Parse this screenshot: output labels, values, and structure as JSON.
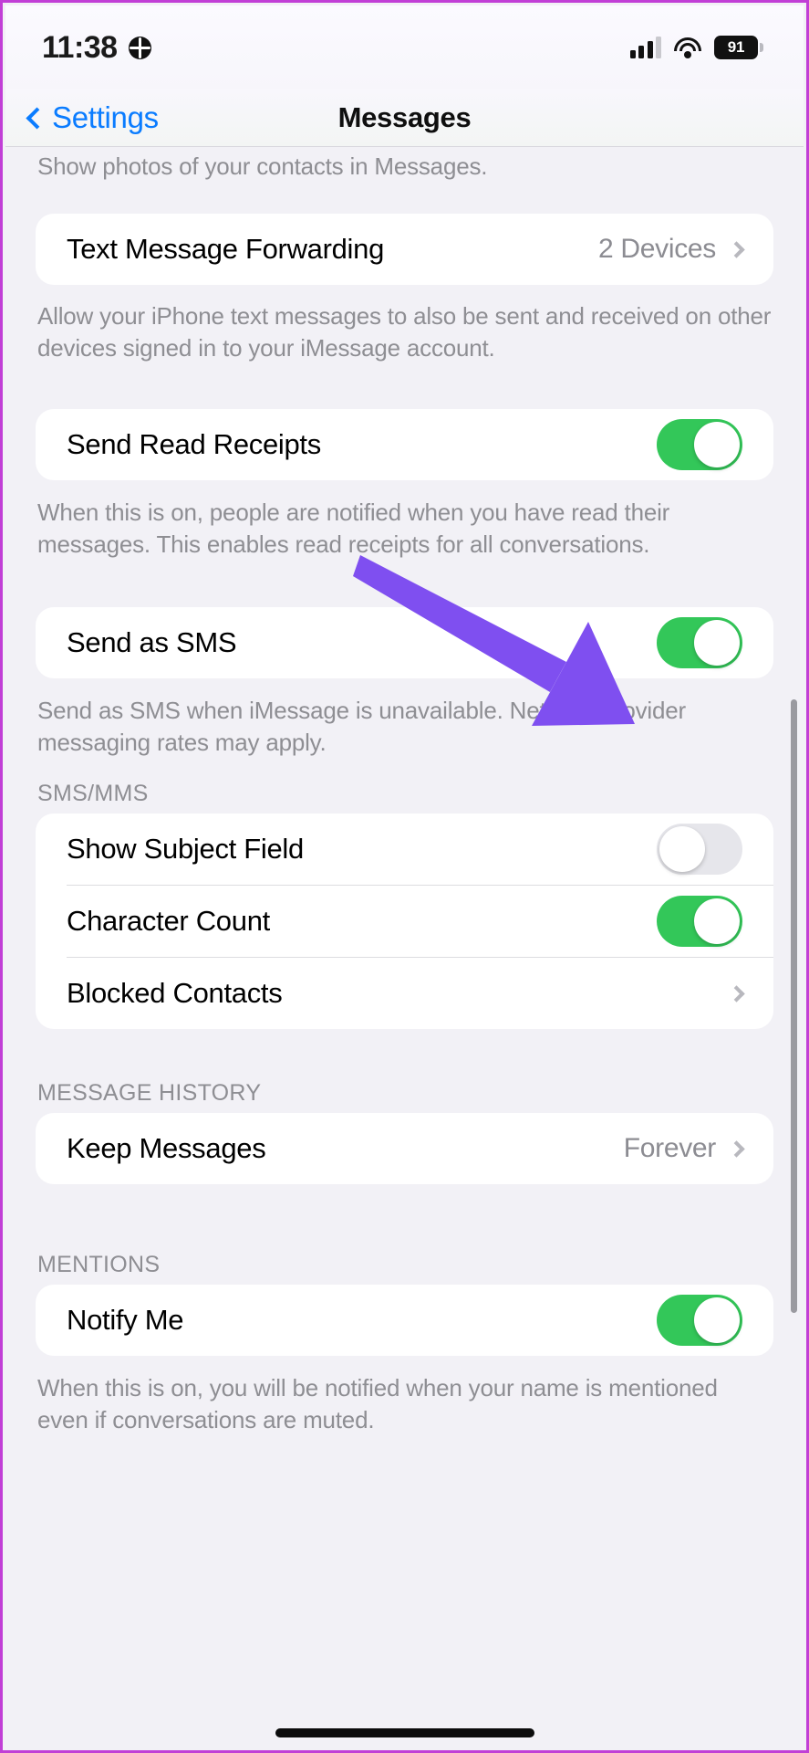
{
  "status_bar": {
    "time": "11:38",
    "globe_icon": "globe-icon",
    "cellular_icon": "cellular-signal-icon",
    "wifi_icon": "wifi-icon",
    "battery_percent": "91"
  },
  "nav_bar": {
    "back_label": "Settings",
    "back_icon": "chevron-left-icon",
    "title": "Messages"
  },
  "sections": {
    "contact_photos_footnote": "Show photos of your contacts in Messages.",
    "text_message_forwarding": {
      "label": "Text Message Forwarding",
      "value": "2 Devices",
      "chevron_icon": "chevron-right-icon",
      "footnote": "Allow your iPhone text messages to also be sent and received on other devices signed in to your iMessage account."
    },
    "send_read_receipts": {
      "label": "Send Read Receipts",
      "state": "on",
      "footnote": "When this is on, people are notified when you have read their messages. This enables read receipts for all conversations."
    },
    "send_as_sms": {
      "label": "Send as SMS",
      "state": "on",
      "footnote": "Send as SMS when iMessage is unavailable. Network provider messaging rates may apply."
    },
    "sms_mms": {
      "header": "SMS/MMS",
      "rows": [
        {
          "label": "Show Subject Field",
          "type": "toggle",
          "state": "off"
        },
        {
          "label": "Character Count",
          "type": "toggle",
          "state": "on"
        },
        {
          "label": "Blocked Contacts",
          "type": "disclosure",
          "value": "",
          "chevron_icon": "chevron-right-icon"
        }
      ]
    },
    "message_history": {
      "header": "MESSAGE HISTORY",
      "rows": [
        {
          "label": "Keep Messages",
          "type": "disclosure",
          "value": "Forever",
          "chevron_icon": "chevron-right-icon"
        }
      ]
    },
    "mentions": {
      "header": "MENTIONS",
      "rows": [
        {
          "label": "Notify Me",
          "type": "toggle",
          "state": "on"
        }
      ],
      "footnote": "When this is on, you will be notified when your name is mentioned even if conversations are muted."
    }
  },
  "annotation": {
    "arrow_color": "#7f4ff0",
    "target": "send-as-sms-toggle"
  },
  "colors": {
    "accent_blue": "#0a7cff",
    "toggle_on_green": "#33c759",
    "toggle_off_gray": "#e6e6eb",
    "background": "#f2f1f6",
    "card": "#ffffff",
    "secondary_text": "#8e8e93",
    "frame_magenta": "#c13fd6"
  }
}
